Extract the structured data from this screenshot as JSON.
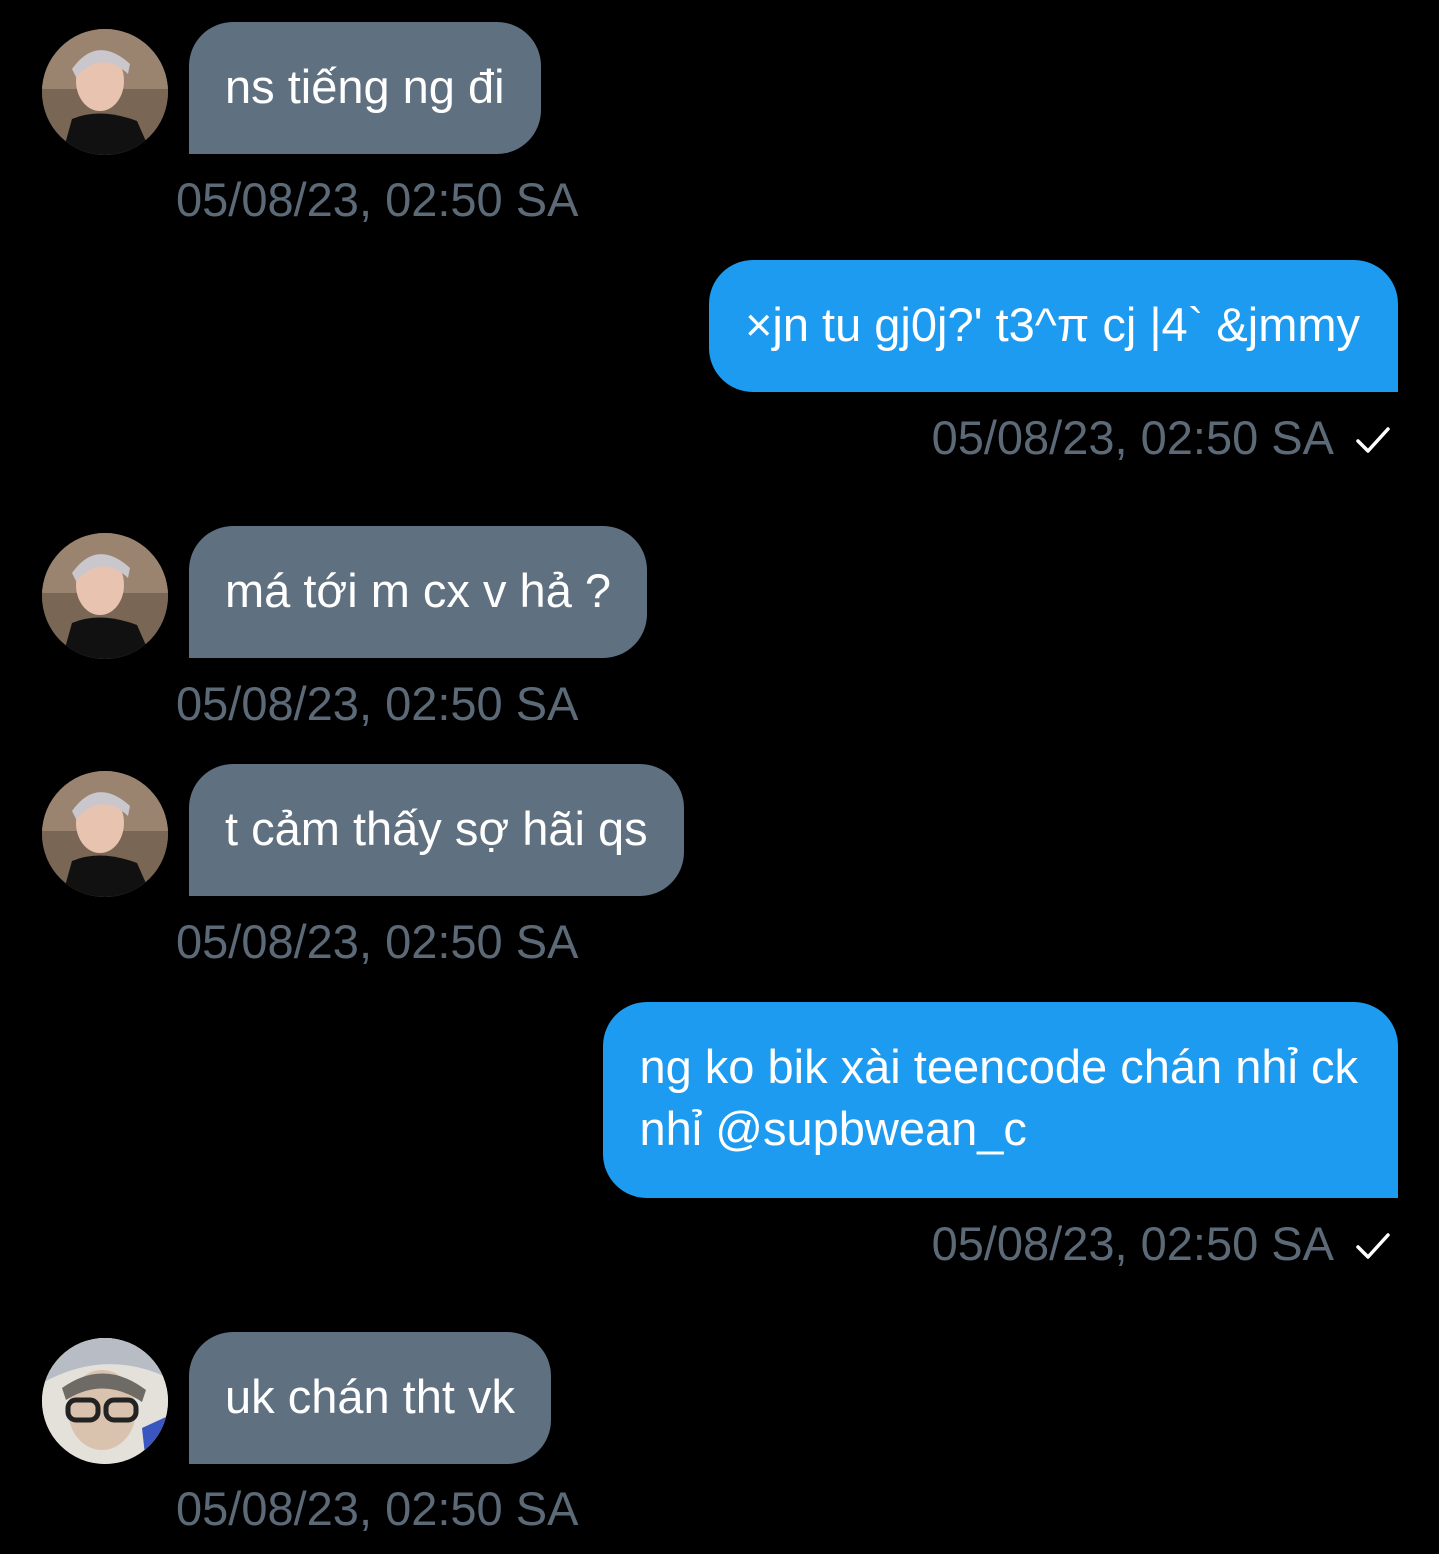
{
  "conversation": {
    "messages": [
      {
        "direction": "incoming",
        "sender_avatar": "avatar-user-1",
        "text": "ns tiếng ng đi",
        "time": "05/08/23, 02:50 SA"
      },
      {
        "direction": "outgoing",
        "text": "×jn tu gj0j?' t3^π cj |4` &jmmy",
        "time": "05/08/23, 02:50 SA",
        "status_icon": "check-icon"
      },
      {
        "direction": "incoming",
        "sender_avatar": "avatar-user-1",
        "text": "má tới m cx v hả ?",
        "time": "05/08/23, 02:50 SA"
      },
      {
        "direction": "incoming",
        "sender_avatar": "avatar-user-1",
        "text": "t cảm thấy sợ hãi qs",
        "time": "05/08/23, 02:50 SA"
      },
      {
        "direction": "outgoing",
        "lines": [
          "ng ko bik xài teencode chán nhỉ ck",
          "nhỉ @supbwean_c"
        ],
        "time": "05/08/23, 02:50 SA",
        "status_icon": "check-icon"
      },
      {
        "direction": "incoming",
        "sender_avatar": "avatar-user-2",
        "text": "uk chán tht vk",
        "time": "05/08/23, 02:50 SA"
      }
    ]
  },
  "colors": {
    "background": "#000000",
    "incoming_bubble": "#5f7081",
    "outgoing_bubble": "#1d9bf0",
    "timestamp": "#5c6a78",
    "message_text": "#ffffff"
  }
}
